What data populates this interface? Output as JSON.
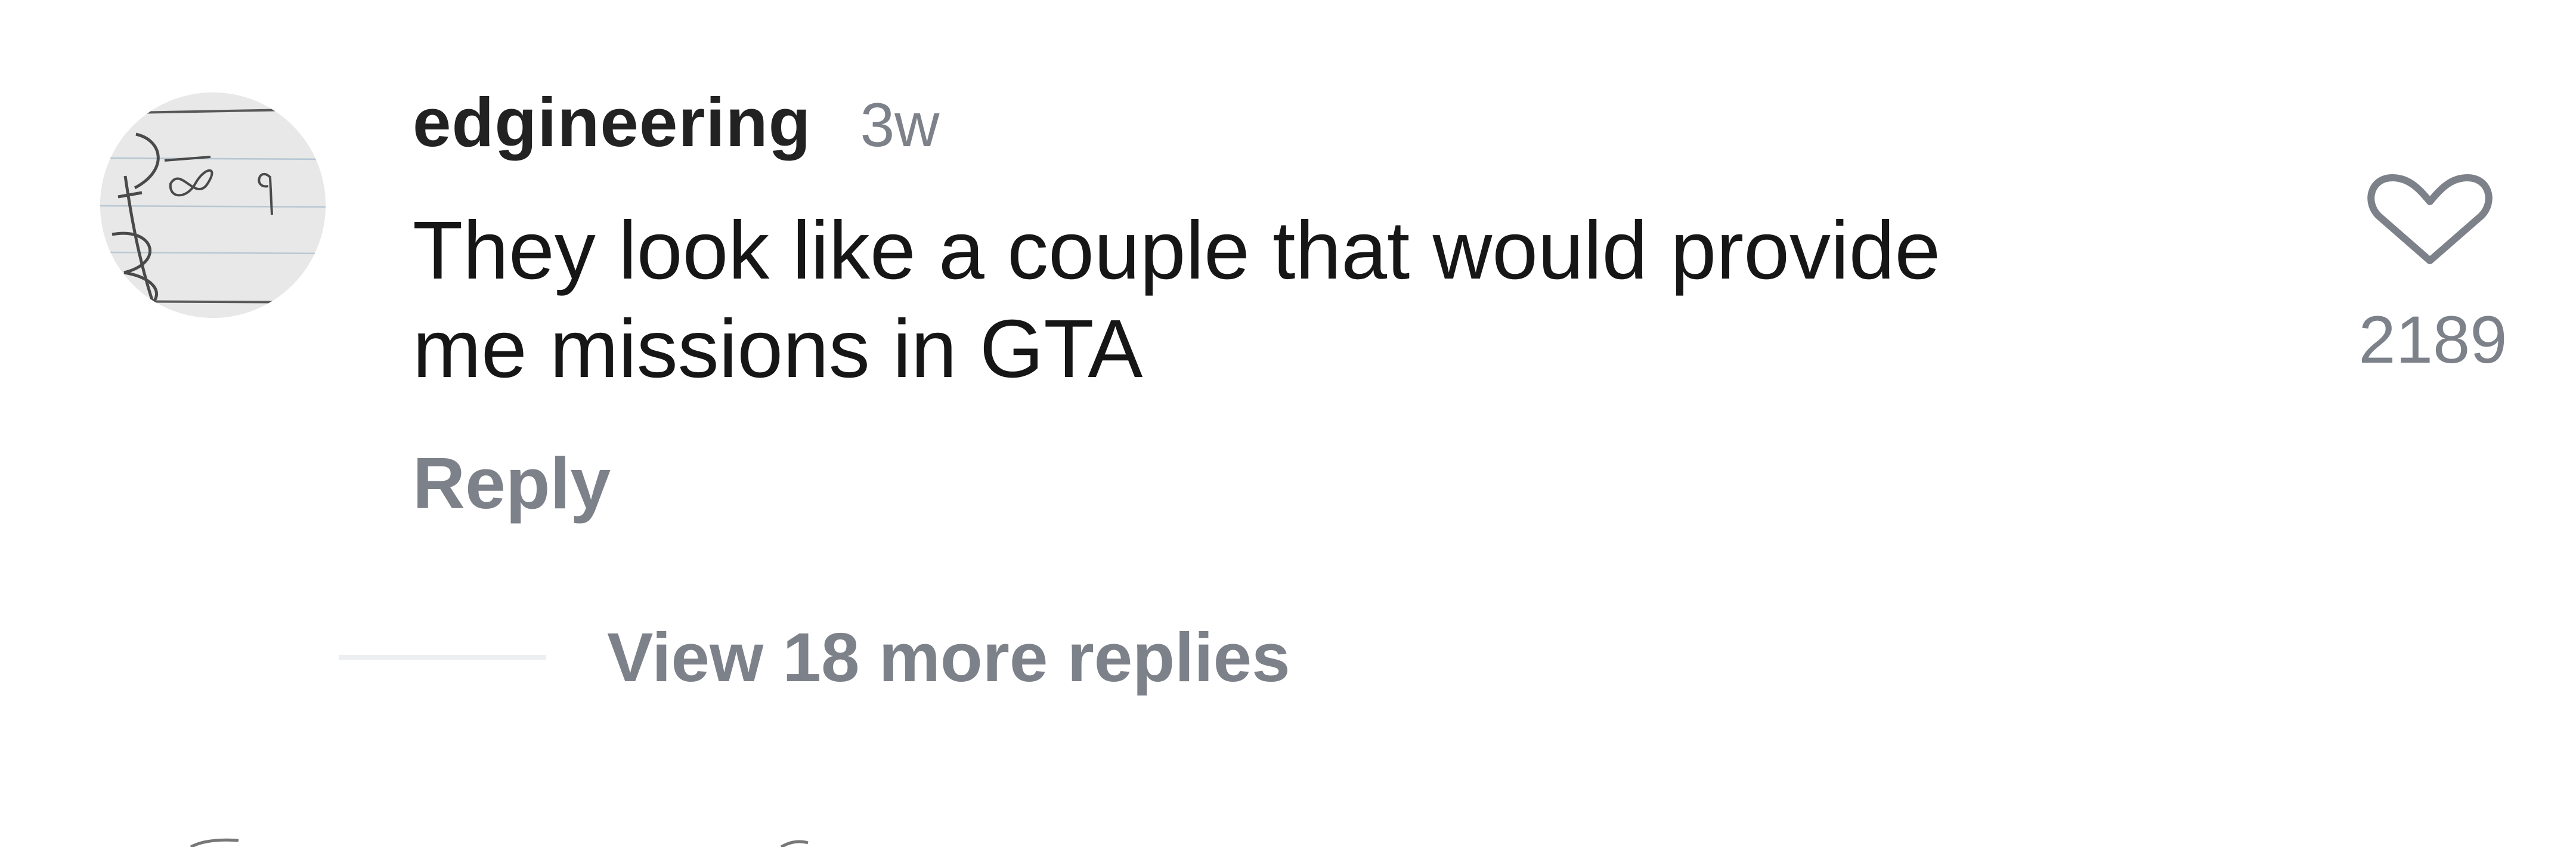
{
  "comment": {
    "username": "edgineering",
    "timestamp": "3w",
    "text": "They look like a couple that would provide\nme missions in GTA",
    "reply_label": "Reply",
    "like_count": "2189",
    "view_replies_label": "View 18 more replies"
  },
  "icons": {
    "like": "heart-outline-icon",
    "avatar": "handwritten-notebook-avatar"
  },
  "colors": {
    "username": "#222222",
    "text": "#161616",
    "muted": "#7d8189",
    "divider": "#eceef2"
  }
}
